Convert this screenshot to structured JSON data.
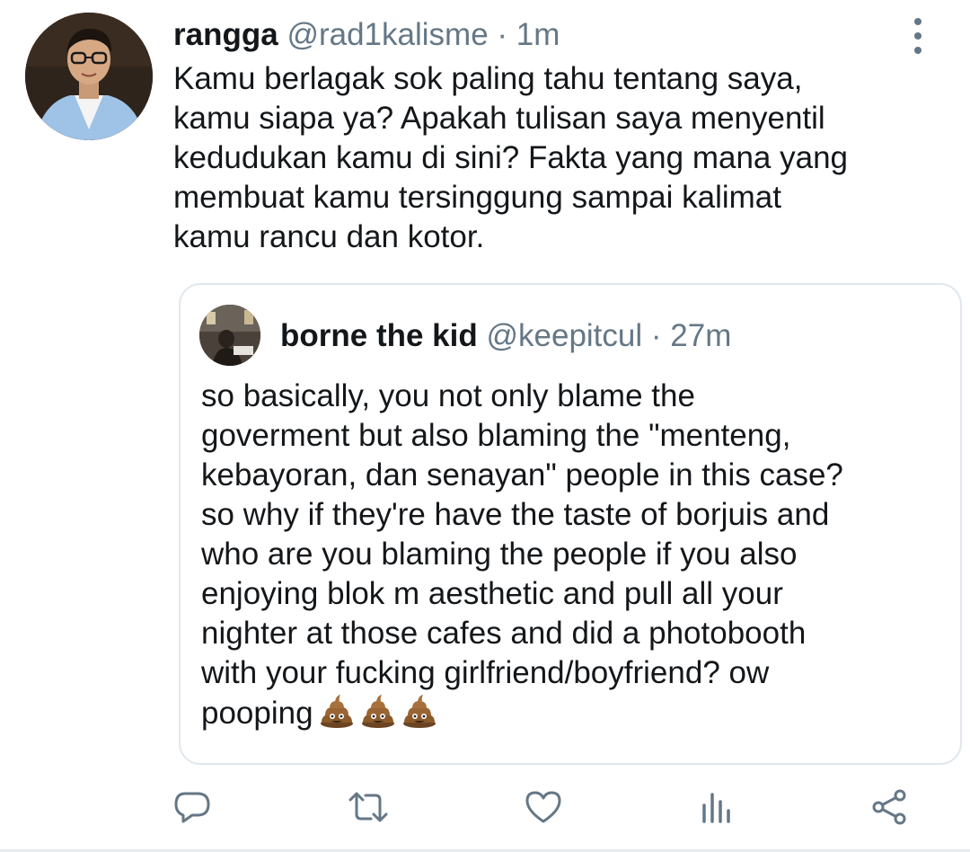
{
  "tweet": {
    "author_name": "rangga",
    "author_handle": "@rad1kalisme",
    "separator": "·",
    "time": "1m",
    "lines": [
      "Kamu berlagak sok paling tahu tentang saya,",
      "kamu siapa ya? Apakah tulisan saya menyentil",
      "kedudukan kamu di sini? Fakta yang mana yang",
      "membuat kamu tersinggung sampai kalimat",
      "kamu rancu dan kotor."
    ]
  },
  "quoted": {
    "author_name": "borne the kid",
    "author_handle": "@keepitcul",
    "separator": "·",
    "time": "27m",
    "lines": [
      "so basically, you not only blame the",
      "goverment but also blaming the \"menteng,",
      "kebayoran, dan senayan\" people in this case?",
      "so why if they're have the taste of borjuis and",
      "who are you blaming the people if you also",
      "enjoying blok m aesthetic and pull all your",
      "nighter at those cafes and did a photobooth",
      "with your fucking girlfriend/boyfriend? ow",
      "pooping"
    ],
    "trailing_emoji": [
      "pile-of-poo",
      "pile-of-poo",
      "pile-of-poo"
    ]
  },
  "actions": {
    "icons": [
      "reply-icon",
      "retweet-icon",
      "like-icon",
      "analytics-icon",
      "share-icon"
    ]
  },
  "colors": {
    "text": "#14171a",
    "secondary": "#657786",
    "border": "#e1e8ed",
    "poo": "#8b5a2b"
  }
}
